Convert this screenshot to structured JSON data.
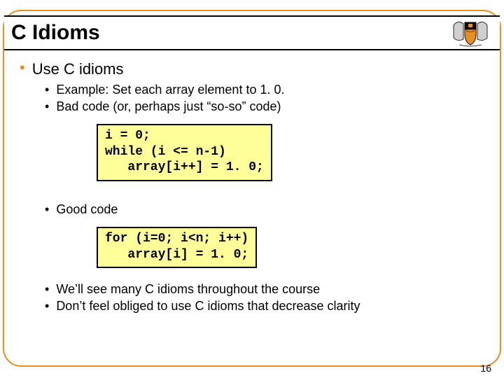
{
  "title": "C Idioms",
  "page_number": "16",
  "bullets": {
    "main": "Use C idioms",
    "sub1": "Example: Set each array element to 1. 0.",
    "sub2": "Bad code (or, perhaps just “so-so” code)",
    "sub3": "Good code",
    "sub4": "We’ll see many C idioms throughout the course",
    "sub5": "Don’t feel obliged to use C idioms that decrease clarity"
  },
  "code": {
    "bad": "i = 0;\nwhile (i <= n-1)\n   array[i++] = 1. 0;",
    "good": "for (i=0; i<n; i++)\n   array[i] = 1. 0;"
  },
  "colors": {
    "border": "#e8901a",
    "code_bg": "#ffff99"
  }
}
